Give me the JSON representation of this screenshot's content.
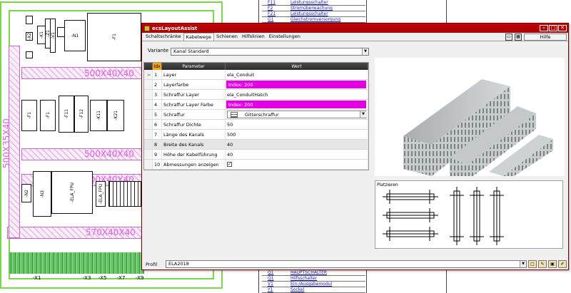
{
  "cad": {
    "duct_labels": [
      "500X40X40",
      "500X40X40",
      "500X40X40",
      "570X40X40",
      "500X35X40"
    ],
    "top_boxes": [
      "-X2",
      "-K1",
      "-Z1",
      "-V1",
      "-N1",
      "-F1"
    ],
    "mid_boxes": [
      "-F1",
      "-F1",
      "-F11",
      "-F12",
      "-K11",
      "-K21"
    ],
    "low_boxes": [
      "-N2",
      "-N3",
      "-ELA_FPU",
      "-ELA_FPU"
    ],
    "terminal_labels": [
      "-X1",
      "-X3",
      "-X5",
      "-X7",
      "-X9"
    ],
    "doc_table_top": [
      [
        "F11",
        "Leistungsschalter"
      ],
      [
        "F2",
        "Stromüberwachung"
      ],
      [
        "F21",
        "Leistungsschalter"
      ],
      [
        "G1",
        "Gleichstromversorgung"
      ]
    ],
    "doc_table_bottom": [
      [
        "Q1",
        "HAUPTSCHALTER"
      ],
      [
        "Q1",
        "Hilfsschalter"
      ],
      [
        "V1",
        "Ein-/Ausgabemodul"
      ],
      [
        "Y1",
        "Sockel"
      ]
    ]
  },
  "window": {
    "title": "ecsLayoutAssist",
    "tabs": [
      "Schaltschränke",
      "Kabelwege",
      "Schienen",
      "Hilfslinien",
      "Einstellungen"
    ],
    "active_tab": "Kabelwege",
    "help_label": "Hilfe",
    "variant_label": "Variante",
    "variant_value": "Kanal Standard",
    "grid_headers": {
      "idx": "Idx",
      "param": "Parameter",
      "value": "Wert"
    },
    "rows": [
      {
        "idx": "1",
        "param": "Layer",
        "value": "ela_Conduit",
        "kind": "text"
      },
      {
        "idx": "2",
        "param": "Layerfarbe",
        "value": "Index: 200",
        "kind": "color"
      },
      {
        "idx": "3",
        "param": "Schraffur Layer",
        "value": "ela_ConduitHatch",
        "kind": "text"
      },
      {
        "idx": "4",
        "param": "Schraffur Layer Farbe",
        "value": "Index: 200",
        "kind": "color"
      },
      {
        "idx": "5",
        "param": "Schraffur",
        "value": "Gitterschraffur",
        "kind": "hatch"
      },
      {
        "idx": "6",
        "param": "Schraffur Dichte",
        "value": "50",
        "kind": "text"
      },
      {
        "idx": "7",
        "param": "Länge des Kanals",
        "value": "500",
        "kind": "text"
      },
      {
        "idx": "8",
        "param": "Breite des Kanals",
        "value": "40",
        "kind": "text"
      },
      {
        "idx": "9",
        "param": "Höhe der Kabelführung",
        "value": "40",
        "kind": "text"
      },
      {
        "idx": "10",
        "param": "Abmessungen anzeigen",
        "value": "✓",
        "kind": "check"
      }
    ],
    "selected_row": "1",
    "placement_label": "Platzieren",
    "profile_label": "Profil",
    "profile_value": "ELA2018",
    "accent_magenta": "#e300e3",
    "title_color": "#c00000"
  }
}
